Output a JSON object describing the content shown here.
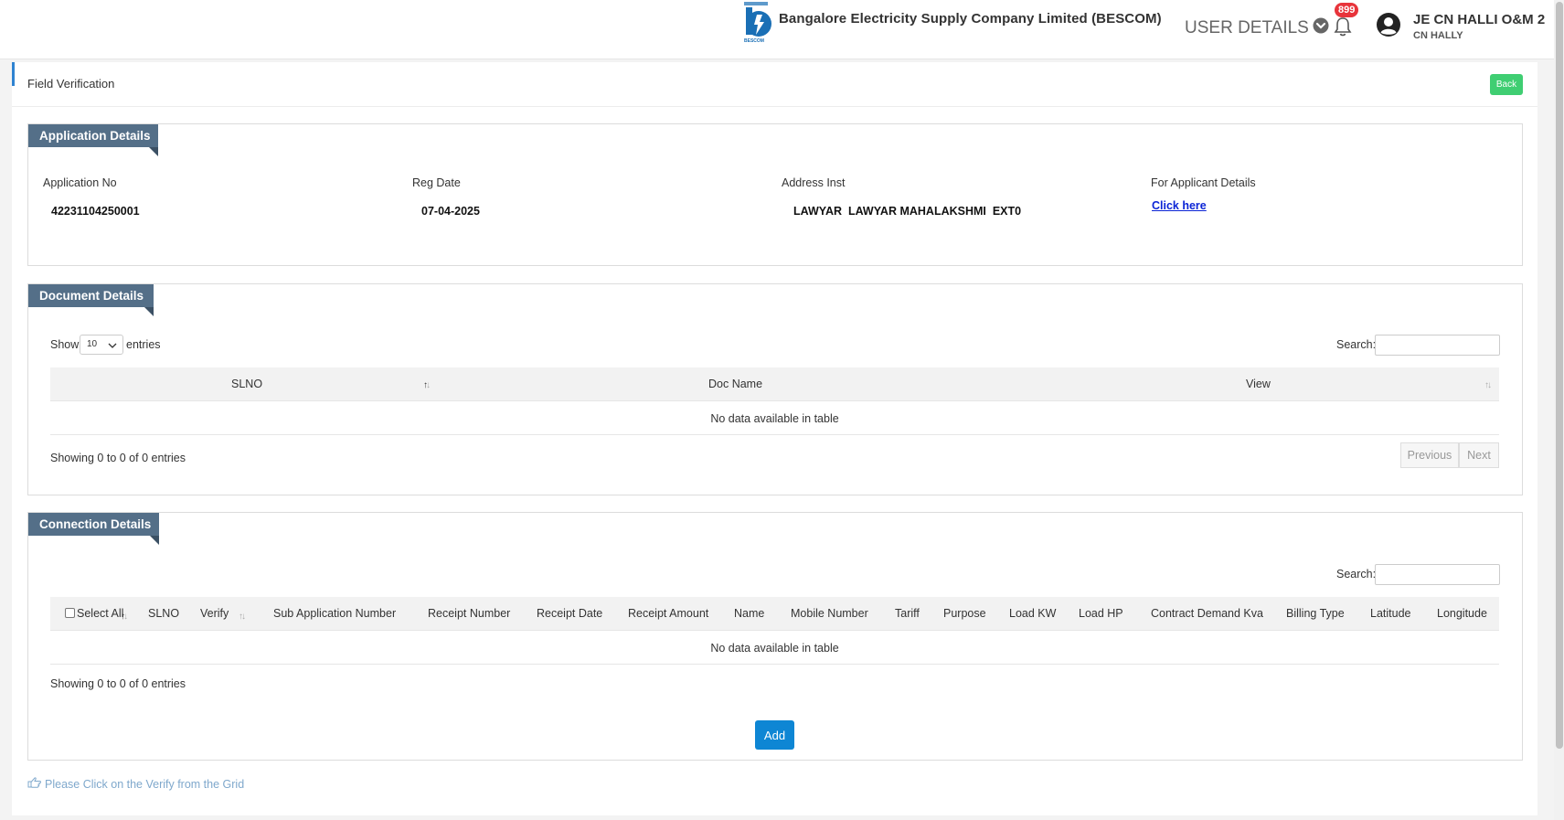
{
  "header": {
    "company_name": "Bangalore Electricity Supply Company Limited (BESCOM)",
    "logo_text": "BESCOM",
    "user_details_label": "USER DETAILS",
    "notification_count": "899",
    "user_name": "JE CN HALLI O&M 2",
    "user_sub": "CN HALLY"
  },
  "page": {
    "title": "Field Verification",
    "back_label": "Back"
  },
  "application": {
    "section_title": "Application Details",
    "fields": {
      "app_no_label": "Application No",
      "app_no_value": "42231104250001",
      "reg_date_label": "Reg Date",
      "reg_date_value": "07-04-2025",
      "address_label": "Address Inst",
      "address_value": "LAWYAR  LAWYAR MAHALAKSHMI  EXT0",
      "applicant_label": "For Applicant Details",
      "applicant_link": "Click here"
    }
  },
  "documents": {
    "section_title": "Document Details",
    "show_label": "Show",
    "entries_label": "entries",
    "page_length": "10",
    "search_label": "Search:",
    "columns": [
      "SLNO",
      "Doc Name",
      "View"
    ],
    "empty_text": "No data available in table",
    "info_text": "Showing 0 to 0 of 0 entries",
    "prev_label": "Previous",
    "next_label": "Next"
  },
  "connections": {
    "section_title": "Connection Details",
    "search_label": "Search:",
    "select_all_label": "Select All",
    "columns": [
      "SLNO",
      "Verify",
      "Sub Application Number",
      "Receipt Number",
      "Receipt Date",
      "Receipt Amount",
      "Name",
      "Mobile Number",
      "Tariff",
      "Purpose",
      "Load KW",
      "Load HP",
      "Contract Demand Kva",
      "Billing Type",
      "Latitude",
      "Longitude"
    ],
    "empty_text": "No data available in table",
    "info_text": "Showing 0 to 0 of 0 entries",
    "add_label": "Add"
  },
  "footer_hint": "Please Click on the Verify from the Grid",
  "colors": {
    "section_tab": "#546f88",
    "back_button": "#3fce72",
    "add_button": "#0e86d4",
    "link": "#0b24d6",
    "badge": "#e8343b"
  }
}
